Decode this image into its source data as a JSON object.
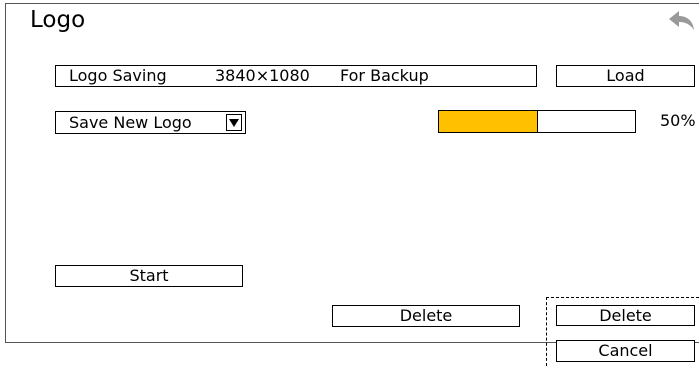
{
  "header": {
    "title": "Logo",
    "back_icon": "back-arrow-icon",
    "back_icon_color": "#9a9a9a"
  },
  "info_bar": {
    "mode": "Logo Saving",
    "resolution": "3840×1080",
    "purpose": "For Backup"
  },
  "load_label": "Load",
  "logo_select": {
    "value": "Save New Logo"
  },
  "progress": {
    "value": 0.5,
    "label": "50%",
    "fill_color": "#FFC000"
  },
  "start_label": "Start",
  "delete_label": "Delete",
  "side_panel": {
    "delete_label": "Delete",
    "cancel_label": "Cancel"
  }
}
